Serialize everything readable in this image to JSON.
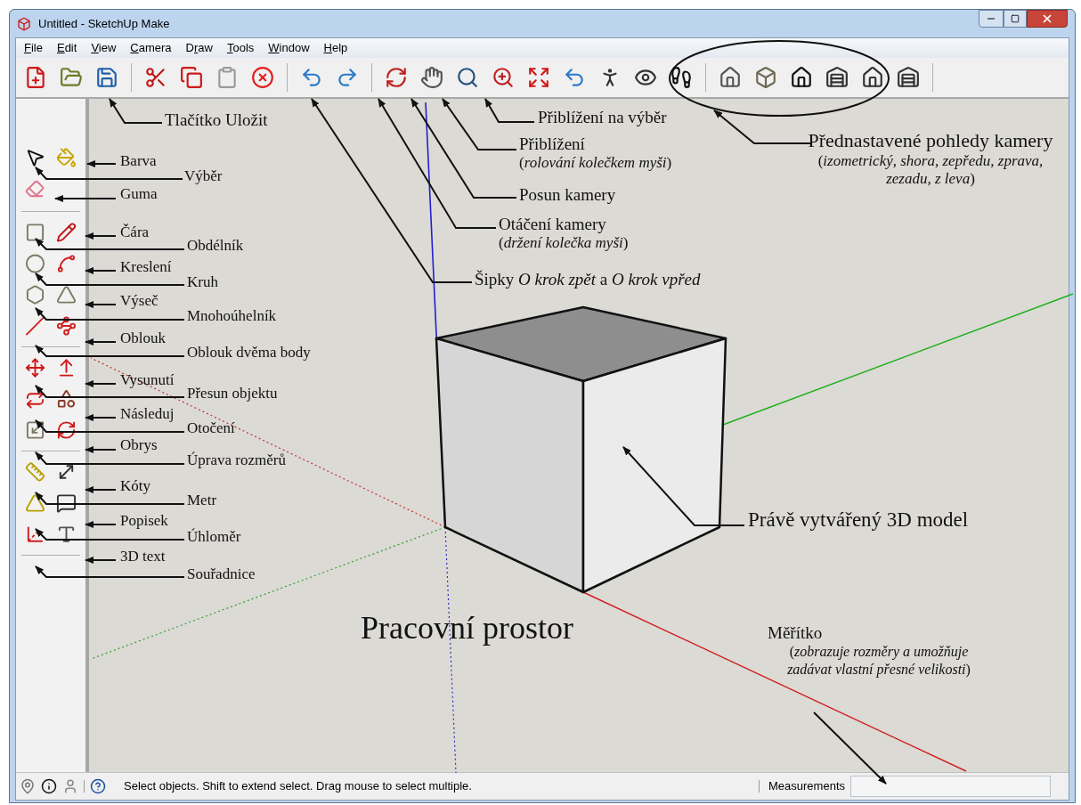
{
  "window": {
    "title": "Untitled - SketchUp Make"
  },
  "menu": [
    {
      "key": "F",
      "post": "ile"
    },
    {
      "key": "E",
      "post": "dit"
    },
    {
      "key": "V",
      "post": "iew"
    },
    {
      "key": "C",
      "post": "amera"
    },
    {
      "pre": "D",
      "key": "r",
      "post": "aw"
    },
    {
      "key": "T",
      "post": "ools"
    },
    {
      "key": "W",
      "post": "indow"
    },
    {
      "key": "H",
      "post": "elp"
    }
  ],
  "callouts": [
    {
      "text": "Tlačítko Uložit"
    },
    {
      "text": "Přiblížení na výběr"
    },
    {
      "text": "Přiblížení",
      "note": "(*rolování kolečkem myši*)"
    },
    {
      "text": "Přednastavené pohledy kamery",
      "note": "(*izometrický, shora, zepředu, zprava, zezadu, z leva*)"
    },
    {
      "text": "Posun kamery"
    },
    {
      "text": "Otáčení kamery",
      "note": "(*držení kolečka myši*)"
    },
    {
      "text": "Šipky *O krok zpět* a *O krok vpřed*"
    },
    {
      "text": "Právě vytvářený 3D model"
    },
    {
      "text": "Měřítko",
      "note": "(*zobrazuje rozměry a umožňuje zadávat vlastní přesné velikosti*)"
    }
  ],
  "tool_callouts": [
    "Barva",
    "Výběr",
    "Guma",
    "Čára",
    "Obdélník",
    "Kreslení",
    "Kruh",
    "Výseč",
    "Mnohoúhelník",
    "Oblouk",
    "Oblouk dvěma body",
    "Vysunutí",
    "Přesun objektu",
    "Následuj",
    "Otočení",
    "Obrys",
    "Úprava rozměrů",
    "Kóty",
    "Metr",
    "Popisek",
    "Úhloměr",
    "3D text",
    "Souřadnice"
  ],
  "workspace_label": "Pracovní prostor",
  "status_bar": {
    "message": "Select objects. Shift to extend select. Drag mouse to select multiple.",
    "measurements_label": "Measurements"
  }
}
